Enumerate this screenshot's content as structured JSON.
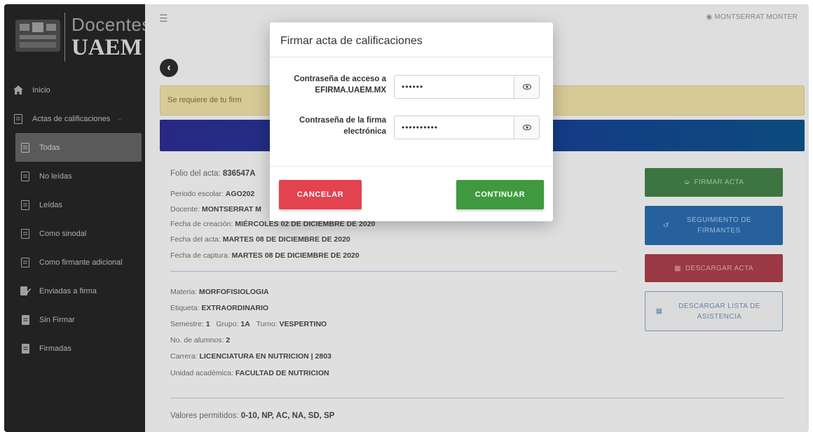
{
  "brand": {
    "top": "Docentes",
    "bottom": "UAEM"
  },
  "topbar": {
    "user": "MONTSERRAT MONTER"
  },
  "sidebar": {
    "items": [
      {
        "label": "Inicio",
        "icon": "home-icon"
      },
      {
        "label": "Actas de calificaciones",
        "icon": "document-icon"
      },
      {
        "label": "Todas",
        "icon": "document-icon"
      },
      {
        "label": "No leídas",
        "icon": "document-icon"
      },
      {
        "label": "Leídas",
        "icon": "document-icon"
      },
      {
        "label": "Como sinodal",
        "icon": "document-icon"
      },
      {
        "label": "Como firmante adicional",
        "icon": "document-icon"
      },
      {
        "label": "Enviadas a firma",
        "icon": "signature-icon"
      },
      {
        "label": "Sin Firmar",
        "icon": "file-icon"
      },
      {
        "label": "Firmadas",
        "icon": "file-icon"
      }
    ]
  },
  "alert": {
    "text": "Se requiere de tu firm"
  },
  "acta": {
    "folio_label": "Folio del acta:",
    "folio": "836547A",
    "periodo_label": "Periodo escolar:",
    "periodo": "AGO202",
    "docente_label": "Docente:",
    "docente": "MONTSERRAT M",
    "creacion_label": "Fecha de creación:",
    "creacion": "MIÉRCOLES 02 DE DICIEMBRE DE 2020",
    "fecha_label": "Fecha del acta:",
    "fecha": "MARTES 08 DE DICIEMBRE DE 2020",
    "captura_label": "Fecha de captura:",
    "captura": "MARTES 08 DE DICIEMBRE DE 2020",
    "materia_label": "Materia:",
    "materia": "MORFOFISIOLOGIA",
    "etiqueta_label": "Etiqueta:",
    "etiqueta": "EXTRAORDINARIO",
    "semestre_label": "Semestre:",
    "semestre": "1",
    "grupo_label": "Grupo:",
    "grupo": "1A",
    "turno_label": "Turno:",
    "turno": "VESPERTINO",
    "alumnos_label": "No. de alumnos:",
    "alumnos": "2",
    "carrera_label": "Carrera:",
    "carrera": "LICENCIATURA EN NUTRICION | 2803",
    "unidad_label": "Unidad académica:",
    "unidad": "FACULTAD DE NUTRICION",
    "valores_label": "Valores permitidos:",
    "valores": "0-10, NP, AC, NA, SD, SP"
  },
  "actions": {
    "firmar": "FIRMAR ACTA",
    "seguimiento": "SEGUIMIENTO DE FIRMANTES",
    "descargar": "DESCARGAR ACTA",
    "lista": "DESCARGAR LISTA DE ASISTENCIA"
  },
  "modal": {
    "title": "Firmar acta de calificaciones",
    "field1_label_line1": "Contraseña de acceso a",
    "field1_label_line2": "EFIRMA.UAEM.MX",
    "field1_value": "••••••",
    "field2_label_line1": "Contraseña de la firma",
    "field2_label_line2": "electrónica",
    "field2_value": "••••••••••",
    "cancel": "CANCELAR",
    "continue": "CONTINUAR"
  },
  "colors": {
    "cancel": "#e3424f",
    "continue": "#3f9a3f",
    "sidebar": "#242424",
    "alert": "#e3d6a0"
  }
}
